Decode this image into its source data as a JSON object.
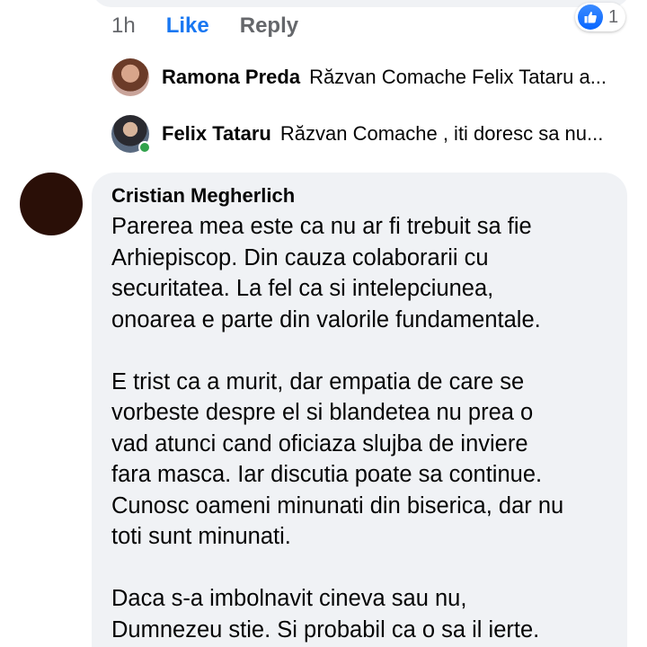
{
  "previous_comment": {
    "time": "1h",
    "like_label": "Like",
    "reply_label": "Reply",
    "reaction_count": "1",
    "reaction_icon": "thumbs-up-icon",
    "reaction_color": "#1877f2"
  },
  "replies": [
    {
      "author": "Ramona Preda",
      "snippet": "Răzvan Comache  Felix Tataru a..."
    },
    {
      "author": "Felix Tataru",
      "snippet": "Răzvan Comache , iti doresc sa nu..."
    }
  ],
  "comment": {
    "author": "Cristian Megherlich",
    "lines": [
      "Parerea mea este ca nu ar fi trebuit sa fie",
      "Arhiepiscop. Din cauza colaborarii cu",
      "securitatea. La fel ca si intelepciunea,",
      "onoarea e parte din valorile fundamentale.",
      "E trist ca a murit, dar empatia de care se",
      "vorbeste despre el si blandetea nu prea o",
      "vad atunci cand oficiaza slujba de inviere",
      "fara masca. Iar discutia poate sa continue.",
      "Cunosc oameni minunati din biserica, dar nu",
      "toti sunt minunati.",
      "Daca s-a imbolnavit cineva sau nu,",
      "Dumnezeu stie. Si probabil ca o sa il ierte."
    ]
  },
  "colors": {
    "link": "#1877f2",
    "muted": "#65676b",
    "bubble": "#f0f2f5",
    "online": "#31a24c"
  }
}
